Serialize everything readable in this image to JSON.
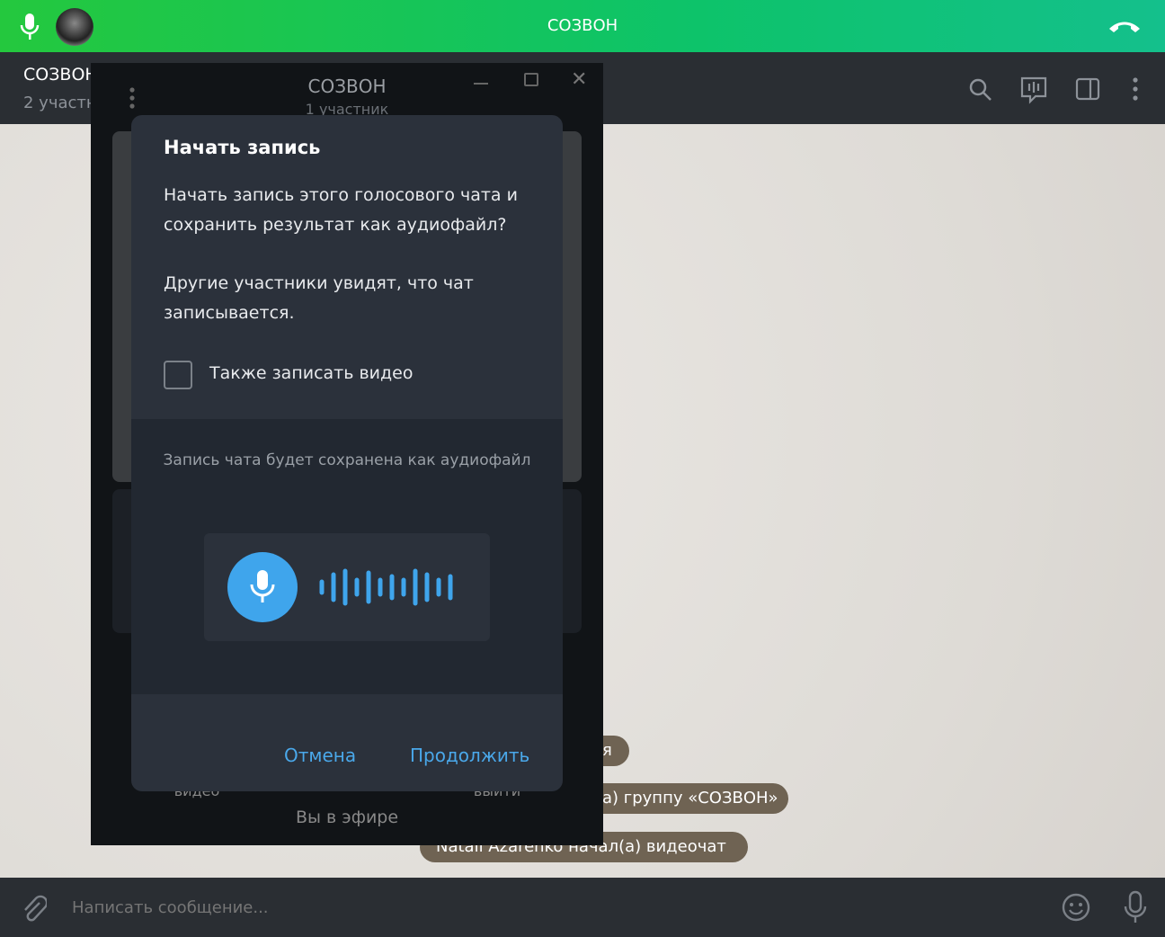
{
  "topbar": {
    "title": "СОЗВОН",
    "icons": [
      "microphone-icon",
      "avatar",
      "hang-up-icon"
    ]
  },
  "header": {
    "chat_title": "СОЗВОН",
    "chat_subtitle": "2 участн",
    "icons": [
      "search-icon",
      "voice-chat-icon",
      "sidebar-toggle-icon",
      "more-vertical-icon"
    ]
  },
  "messages": [
    "я",
    "а) группу «СОЗВОН»",
    "Natali Azarenko начал(а) видеочат"
  ],
  "call_window": {
    "title": "СОЗВОН",
    "subtitle": "1 участник",
    "left_label": "видео",
    "right_label": "выйти",
    "status": "Вы в эфире"
  },
  "dialog": {
    "title": "Начать запись",
    "text1": "Начать запись этого голосового чата и сохранить результат как аудиофайл?",
    "text2": "Другие участники увидят, что чат записывается.",
    "checkbox_label": "Также записать видео",
    "checkbox_checked": false,
    "info": "Запись чата будет сохранена как аудиофайл",
    "cancel": "Отмена",
    "continue": "Продолжить",
    "accent": "#4aa8ea"
  },
  "composer": {
    "placeholder": "Написать сообщение..."
  }
}
